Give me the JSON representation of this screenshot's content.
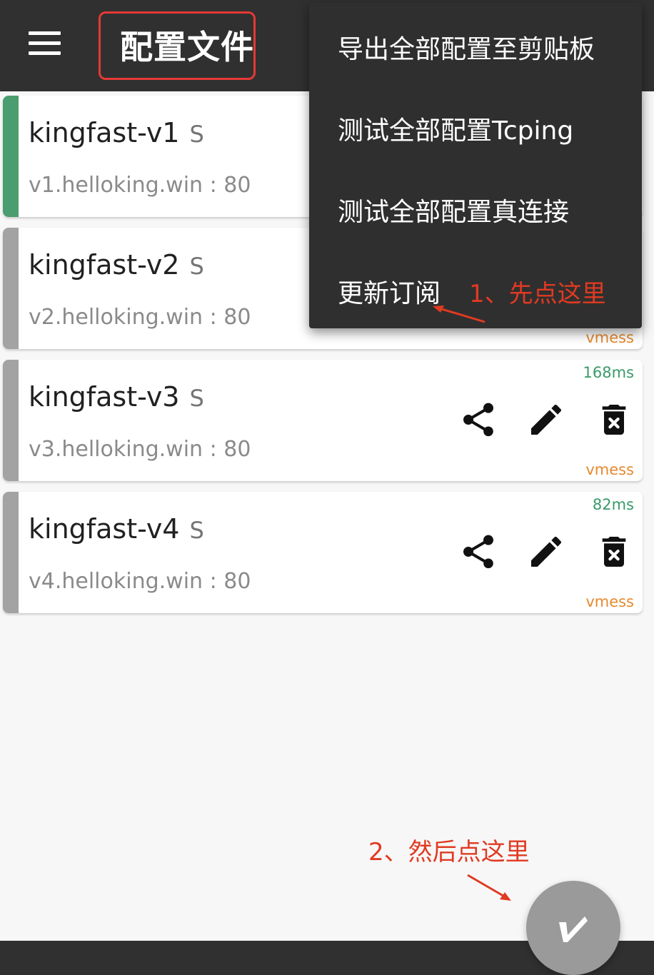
{
  "header": {
    "title": "配置文件",
    "menu_icon": "menu-icon"
  },
  "colors": {
    "appbar": "#303030",
    "annotation": "#e03a22",
    "selected_bar": "#4a9d6e",
    "unselected_bar": "#a3a3a3",
    "delay": "#3a9a6a",
    "protocol": "#e58a2e"
  },
  "servers": [
    {
      "name": "kingfast-v1",
      "tag": "S",
      "host": "v1.helloking.win : 80",
      "delay": "",
      "protocol": "",
      "selected": true
    },
    {
      "name": "kingfast-v2",
      "tag": "S",
      "host": "v2.helloking.win : 80",
      "delay": "",
      "protocol": "vmess",
      "selected": false
    },
    {
      "name": "kingfast-v3",
      "tag": "S",
      "host": "v3.helloking.win : 80",
      "delay": "168ms",
      "protocol": "vmess",
      "selected": false
    },
    {
      "name": "kingfast-v4",
      "tag": "S",
      "host": "v4.helloking.win : 80",
      "delay": "82ms",
      "protocol": "vmess",
      "selected": false
    }
  ],
  "actions": [
    "share-icon",
    "edit-icon",
    "delete-icon"
  ],
  "menu": {
    "items": [
      "导出全部配置至剪贴板",
      "测试全部配置Tcping",
      "测试全部配置真连接",
      "更新订阅"
    ]
  },
  "annotations": {
    "step1": "1、先点这里",
    "step2": "2、然后点这里"
  },
  "fab": {
    "icon": "v2ray-logo-icon"
  }
}
